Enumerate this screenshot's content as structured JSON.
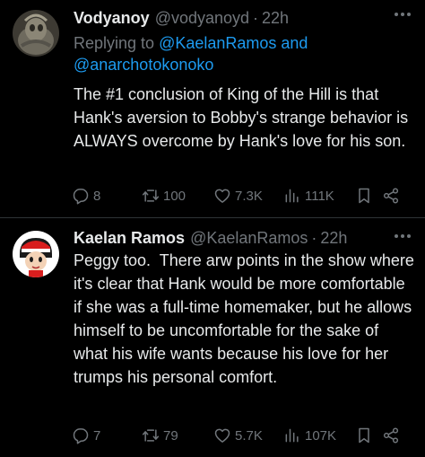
{
  "tweets": [
    {
      "name": "Vodyanoy",
      "handle": "@vodyanoyd",
      "separator": "·",
      "time": "22h",
      "replying_prefix": "Replying to ",
      "replying_users": "@KaelanRamos and @anarchotokonoko",
      "text": "The #1 conclusion of King of the Hill is that Hank's aversion to Bobby's strange behavior is ALWAYS overcome by Hank's love for his son.",
      "stats": {
        "replies": "8",
        "retweets": "100",
        "likes": "7.3K",
        "views": "111K"
      }
    },
    {
      "name": "Kaelan Ramos",
      "handle": "@KaelanRamos",
      "separator": "·",
      "time": "22h",
      "text": "Peggy too.  There arw points in the show where it's clear that Hank would be more comfortable if she was a full-time homemaker, but he allows himself to be uncomfortable for the sake of what his wife wants because his love for her trumps his personal comfort.",
      "stats": {
        "replies": "7",
        "retweets": "79",
        "likes": "5.7K",
        "views": "107K"
      }
    }
  ],
  "colors": {
    "background": "#000000",
    "text": "#e7e9ea",
    "secondary": "#71767b",
    "link": "#1d9bf0",
    "divider": "#2f3336"
  },
  "icons": [
    "reply-icon",
    "retweet-icon",
    "like-icon",
    "views-icon",
    "bookmark-icon",
    "share-icon",
    "more-icon"
  ]
}
